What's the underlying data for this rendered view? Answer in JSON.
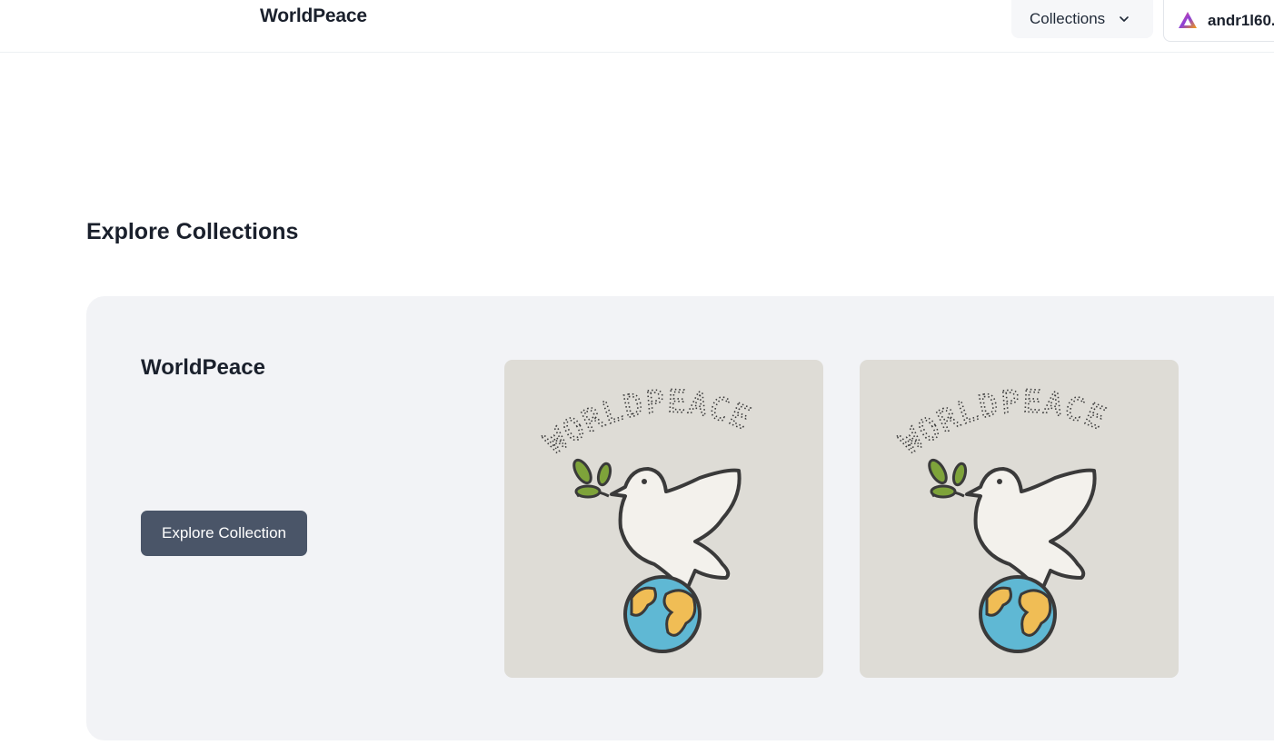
{
  "header": {
    "brand": "WorldPeace",
    "collections_label": "Collections",
    "account_label": "andr1l60..."
  },
  "main": {
    "section_title": "Explore Collections",
    "collection": {
      "title": "WorldPeace",
      "button_label": "Explore Collection",
      "artwork_text": "WORLDPEACE"
    }
  },
  "colors": {
    "primary_button": "#4a5568",
    "card_background": "#f2f3f6",
    "thumb_background": "#dedcd6"
  },
  "icons": [
    "chevron-down-icon",
    "wallet-logo-icon",
    "dove-globe-artwork"
  ]
}
